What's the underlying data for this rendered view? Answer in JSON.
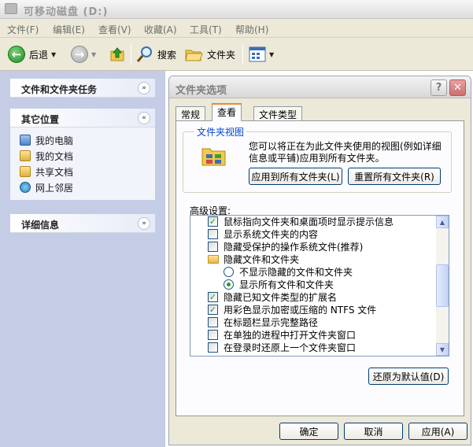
{
  "window": {
    "title": "可移动磁盘 (D:)"
  },
  "menu": [
    {
      "label": "文件(F)"
    },
    {
      "label": "编辑(E)"
    },
    {
      "label": "查看(V)"
    },
    {
      "label": "收藏(A)"
    },
    {
      "label": "工具(T)"
    },
    {
      "label": "帮助(H)"
    }
  ],
  "toolbar": {
    "back_label": "后退",
    "search_label": "搜索",
    "folders_label": "文件夹"
  },
  "sidebar": {
    "tasks_title": "文件和文件夹任务",
    "places_title": "其它位置",
    "places": [
      {
        "label": "我的电脑"
      },
      {
        "label": "我的文档"
      },
      {
        "label": "共享文档"
      },
      {
        "label": "网上邻居"
      }
    ],
    "details_title": "详细信息"
  },
  "dialog": {
    "title": "文件夹选项",
    "tabs": [
      "常规",
      "查看",
      "文件类型"
    ],
    "active_tab": "查看",
    "group_title": "文件夹视图",
    "group_desc": "您可以将正在为此文件夹使用的视图(例如详细信息或平铺)应用到所有文件夹。",
    "apply_all_label": "应用到所有文件夹(L)",
    "reset_all_label": "重置所有文件夹(R)",
    "advanced_label": "高级设置:",
    "settings": [
      {
        "type": "checkbox",
        "checked": true,
        "label": "鼠标指向文件夹和桌面项时显示提示信息"
      },
      {
        "type": "checkbox",
        "checked": false,
        "label": "显示系统文件夹的内容"
      },
      {
        "type": "checkbox",
        "checked": false,
        "label": "隐藏受保护的操作系统文件(推荐)"
      },
      {
        "type": "folder",
        "label": "隐藏文件和文件夹"
      },
      {
        "type": "radio",
        "checked": false,
        "label": "不显示隐藏的文件和文件夹"
      },
      {
        "type": "radio",
        "checked": true,
        "label": "显示所有文件和文件夹"
      },
      {
        "type": "checkbox",
        "checked": true,
        "label": "隐藏已知文件类型的扩展名"
      },
      {
        "type": "checkbox",
        "checked": true,
        "label": "用彩色显示加密或压缩的 NTFS 文件"
      },
      {
        "type": "checkbox",
        "checked": false,
        "label": "在标题栏显示完整路径"
      },
      {
        "type": "checkbox",
        "checked": false,
        "label": "在单独的进程中打开文件夹窗口"
      },
      {
        "type": "checkbox",
        "checked": false,
        "label": "在登录时还原上一个文件夹窗口"
      }
    ],
    "restore_label": "还原为默认值(D)",
    "ok_label": "确定",
    "cancel_label": "取消",
    "apply_label": "应用(A)"
  },
  "colors": {
    "accent": "#e68b2c",
    "group_title": "#0046d5",
    "check": "#21a121"
  }
}
